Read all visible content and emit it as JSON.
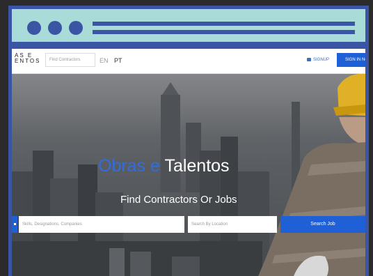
{
  "logo": {
    "line1": "AS E",
    "line2": "ENTOS"
  },
  "navbar": {
    "search_placeholder": "Find Contractors",
    "lang_en": "EN",
    "lang_pt": "PT",
    "signup": "SIGNUP",
    "signin": "SIGN IN NO"
  },
  "hero": {
    "title_blue": "Obras e",
    "title_white": "Talentos",
    "subtitle": "Find Contractors Or Jobs",
    "skills_placeholder": "Skills, Designations, Companies",
    "location_placeholder": "Search By Location",
    "search_button": "Search Job"
  },
  "colors": {
    "frame": "#3b55a5",
    "titlebar": "#a9dcd8",
    "accent": "#1f60d6",
    "title_blue": "#2f6de0"
  }
}
